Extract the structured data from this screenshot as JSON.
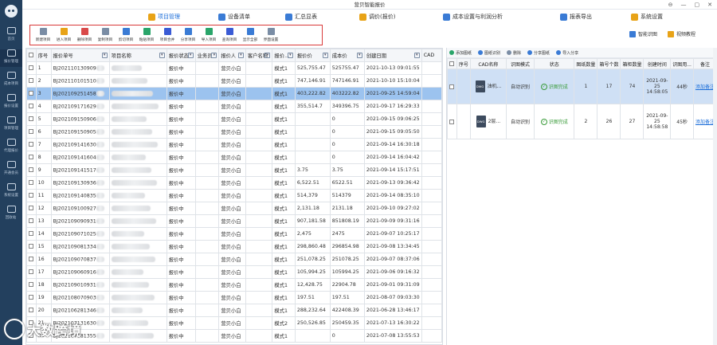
{
  "app": {
    "title": "营贝智能报价"
  },
  "window_controls": [
    "⊖",
    "—",
    "▢",
    "✕"
  ],
  "sidebar": {
    "items": [
      {
        "label": "首页"
      },
      {
        "label": "报价管理"
      },
      {
        "label": "成本项目"
      },
      {
        "label": "报价设置"
      },
      {
        "label": "项目管理"
      },
      {
        "label": "代理报价"
      },
      {
        "label": "开通会员"
      },
      {
        "label": "系统设置"
      },
      {
        "label": "回收站"
      }
    ]
  },
  "topnav": [
    {
      "label": "项目管理",
      "icon": "project-icon",
      "color": "#e8a317",
      "active": true
    },
    {
      "label": "设备清单",
      "icon": "device-list-icon",
      "color": "#3a7bd5"
    },
    {
      "label": "汇总显表",
      "icon": "summary-icon",
      "color": "#3a7bd5"
    },
    {
      "label": "调价(报价)",
      "icon": "price-adjust-icon",
      "color": "#e8a317"
    },
    {
      "label": "成本设置与利润分析",
      "icon": "cost-icon",
      "color": "#3a7bd5"
    },
    {
      "label": "报表导出",
      "icon": "export-report-icon",
      "color": "#3a7bd5"
    },
    {
      "label": "系统设置",
      "icon": "settings-icon",
      "color": "#e8a317"
    }
  ],
  "toolbar": [
    {
      "label": "新建项目",
      "icon": "new-project-icon",
      "color": "#7a8da5"
    },
    {
      "label": "进入项目",
      "icon": "open-project-icon",
      "color": "#e8a317"
    },
    {
      "label": "删除项目",
      "icon": "delete-project-icon",
      "color": "#d94a4a"
    },
    {
      "label": "复制项目",
      "icon": "copy-project-icon",
      "color": "#7a8da5"
    },
    {
      "label": "剪切项目",
      "icon": "cut-project-icon",
      "color": "#3a7bd5"
    },
    {
      "label": "粘贴项目",
      "icon": "paste-project-icon",
      "color": "#2aa56a"
    },
    {
      "label": "项目合并",
      "icon": "merge-project-icon",
      "color": "#3a5bd5"
    },
    {
      "label": "分享项目",
      "icon": "share-project-icon",
      "color": "#3a7bd5"
    },
    {
      "label": "导入项目",
      "icon": "import-project-icon",
      "color": "#2aa56a"
    },
    {
      "label": "查询项目",
      "icon": "search-project-icon",
      "color": "#3a5bd5"
    },
    {
      "label": "显示全部",
      "icon": "show-all-icon",
      "color": "#3a7bd5"
    },
    {
      "label": "界面设置",
      "icon": "ui-settings-icon",
      "color": "#7a8da5"
    }
  ],
  "right_tools": [
    {
      "label": "智能识图",
      "icon": "smart-recognize-icon",
      "color": "#3a7bd5"
    },
    {
      "label": "视频教程",
      "icon": "video-tutorial-icon",
      "color": "#e8a317"
    }
  ],
  "project_table": {
    "headers": [
      "序号",
      "报价单号",
      "项目名称",
      "报价状态",
      "业务员",
      "报价人",
      "客户名称",
      "报价...",
      "报价价",
      "成本价",
      "创建日期",
      "CAD"
    ],
    "rows": [
      {
        "no": "1",
        "code": "BJ202110130909",
        "status": "报价中",
        "quoter": "营贝小白",
        "tpl": "模式1",
        "price": "525,755.47",
        "cost": "525755.47",
        "date": "2021-10-13 09:01:55"
      },
      {
        "no": "2",
        "code": "BJ202110101510",
        "status": "报价中",
        "quoter": "营贝小白",
        "tpl": "模式1",
        "price": "747,146.91",
        "cost": "747146.91",
        "date": "2021-10-10 15:10:04"
      },
      {
        "no": "3",
        "code": "BJ202109251458",
        "status": "报价中",
        "quoter": "营贝小白",
        "tpl": "模式1",
        "price": "403,222.82",
        "cost": "403222.82",
        "date": "2021-09-25 14:59:04"
      },
      {
        "no": "4",
        "code": "BJ202109171629",
        "status": "报价中",
        "quoter": "营贝小白",
        "tpl": "模式1",
        "price": "355,514.7",
        "cost": "349396.75",
        "date": "2021-09-17 16:29:33"
      },
      {
        "no": "5",
        "code": "BJ202109150906",
        "status": "报价中",
        "quoter": "营贝小白",
        "tpl": "模式1",
        "price": "",
        "cost": "0",
        "date": "2021-09-15 09:06:25"
      },
      {
        "no": "6",
        "code": "BJ202109150905",
        "status": "报价中",
        "quoter": "营贝小白",
        "tpl": "模式1",
        "price": "",
        "cost": "0",
        "date": "2021-09-15 09:05:50"
      },
      {
        "no": "7",
        "code": "BJ202109141630",
        "status": "报价中",
        "quoter": "营贝小白",
        "tpl": "模式1",
        "price": "",
        "cost": "0",
        "date": "2021-09-14 16:30:18"
      },
      {
        "no": "8",
        "code": "BJ202109141604",
        "status": "报价中",
        "quoter": "营贝小白",
        "tpl": "模式1",
        "price": "",
        "cost": "0",
        "date": "2021-09-14 16:04:42"
      },
      {
        "no": "9",
        "code": "BJ202109141517",
        "status": "报价中",
        "quoter": "营贝小白",
        "tpl": "模式1",
        "price": "3.75",
        "cost": "3.75",
        "date": "2021-09-14 15:17:51"
      },
      {
        "no": "10",
        "code": "BJ202109130936",
        "status": "报价中",
        "quoter": "营贝小白",
        "tpl": "模式1",
        "price": "6,522.51",
        "cost": "6522.51",
        "date": "2021-09-13 09:36:42"
      },
      {
        "no": "11",
        "code": "BJ202109140835",
        "status": "报价中",
        "quoter": "营贝小白",
        "tpl": "模式1",
        "price": "514,379",
        "cost": "514379",
        "date": "2021-09-14 08:35:10"
      },
      {
        "no": "12",
        "code": "BJ202109100927",
        "status": "报价中",
        "quoter": "营贝小白",
        "tpl": "模式1",
        "price": "2,131.18",
        "cost": "2131.18",
        "date": "2021-09-10 09:27:02"
      },
      {
        "no": "13",
        "code": "BJ202109090931",
        "status": "报价中",
        "quoter": "营贝小白",
        "tpl": "模式1",
        "price": "907,181.58",
        "cost": "851808.19",
        "date": "2021-09-09 09:31:16"
      },
      {
        "no": "14",
        "code": "BJ202109071025",
        "status": "报价中",
        "quoter": "营贝小白",
        "tpl": "模式1",
        "price": "2,475",
        "cost": "2475",
        "date": "2021-09-07 10:25:17"
      },
      {
        "no": "15",
        "code": "BJ202109081334",
        "status": "报价中",
        "quoter": "营贝小白",
        "tpl": "模式1",
        "price": "298,860.48",
        "cost": "296854.98",
        "date": "2021-09-08 13:34:45"
      },
      {
        "no": "16",
        "code": "BJ202109070837",
        "status": "报价中",
        "quoter": "营贝小白",
        "tpl": "模式1",
        "price": "251,078.25",
        "cost": "251078.25",
        "date": "2021-09-07 08:37:06"
      },
      {
        "no": "17",
        "code": "BJ202109060916",
        "status": "报价中",
        "quoter": "营贝小白",
        "tpl": "模式1",
        "price": "105,994.25",
        "cost": "105994.25",
        "date": "2021-09-06 09:16:32"
      },
      {
        "no": "18",
        "code": "BJ202109010931",
        "status": "报价中",
        "quoter": "营贝小白",
        "tpl": "模式1",
        "price": "12,428.75",
        "cost": "22904.78",
        "date": "2021-09-01 09:31:09"
      },
      {
        "no": "19",
        "code": "BJ202108070903",
        "status": "报价中",
        "quoter": "营贝小白",
        "tpl": "模式1",
        "price": "197.51",
        "cost": "197.51",
        "date": "2021-08-07 09:03:30"
      },
      {
        "no": "20",
        "code": "BJ202106281346",
        "status": "报价中",
        "quoter": "营贝小白",
        "tpl": "模式1",
        "price": "288,232.64",
        "cost": "422408.39",
        "date": "2021-06-28 13:46:17"
      },
      {
        "no": "21",
        "code": "BJ202107131630",
        "status": "报价中",
        "quoter": "营贝小白",
        "tpl": "模式2",
        "price": "250,526.85",
        "cost": "250459.35",
        "date": "2021-07-13 16:30:22"
      },
      {
        "no": "22",
        "code": "BJ202107081355",
        "status": "报价中",
        "quoter": "营贝小白",
        "tpl": "模式1",
        "price": "",
        "cost": "0",
        "date": "2021-07-08 13:55:53"
      }
    ]
  },
  "cad_tools": [
    {
      "label": "添加图纸",
      "color": "#2aa56a"
    },
    {
      "label": "图纸识别",
      "color": "#3a7bd5"
    },
    {
      "label": "删除",
      "color": "#7a8da5"
    },
    {
      "label": "分享图纸",
      "color": "#3a7bd5"
    },
    {
      "label": "导入分享",
      "color": "#3a7bd5"
    }
  ],
  "cad_table": {
    "headers": [
      "序号",
      "CAD名称",
      "识图模式",
      "状态",
      "图纸数量",
      "箱号个数",
      "箱柜数量",
      "创建时间",
      "识图用...",
      "备注"
    ],
    "rows": [
      {
        "name": "油机...",
        "mode": "自动识别",
        "status": "识图完成",
        "sheets": "1",
        "boxes": "17",
        "cabinets": "74",
        "created": "2021-09-25 14:58:05",
        "duration": "44秒",
        "note": "添加备注"
      },
      {
        "name": "2层...",
        "mode": "自动识别",
        "status": "识图完成",
        "sheets": "2",
        "boxes": "26",
        "cabinets": "27",
        "created": "2021-09-25 14:58:58",
        "duration": "45秒",
        "note": "添加备注"
      }
    ]
  },
  "watermark": {
    "text": "大数跨境"
  }
}
